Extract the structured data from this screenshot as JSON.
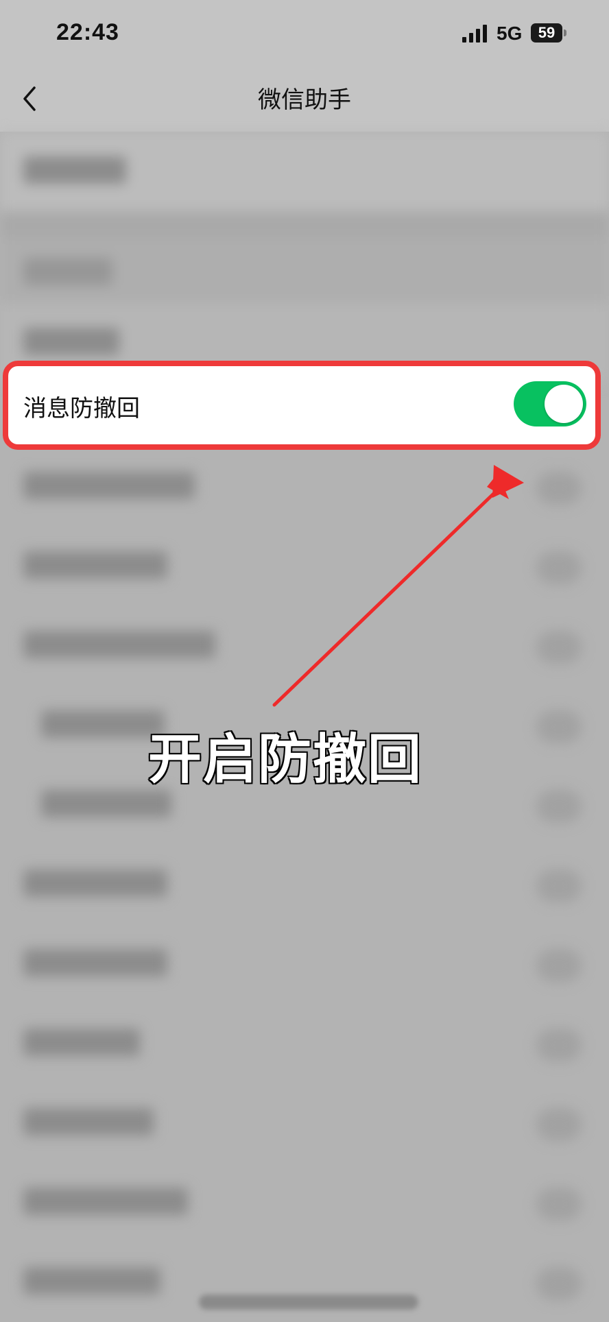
{
  "status_bar": {
    "time": "22:43",
    "network": "5G",
    "battery": "59",
    "signal_icon": "signal-bars-icon",
    "battery_icon": "battery-icon"
  },
  "nav": {
    "title": "微信助手",
    "back_icon": "chevron-left-icon"
  },
  "setting_row": {
    "label": "消息防撤回",
    "toggle_on": true,
    "toggle_color": "#08c160"
  },
  "annotation": {
    "text": "开启防撤回",
    "highlight_color": "#ee3a3a",
    "arrow_color": "#ee2a2a"
  }
}
